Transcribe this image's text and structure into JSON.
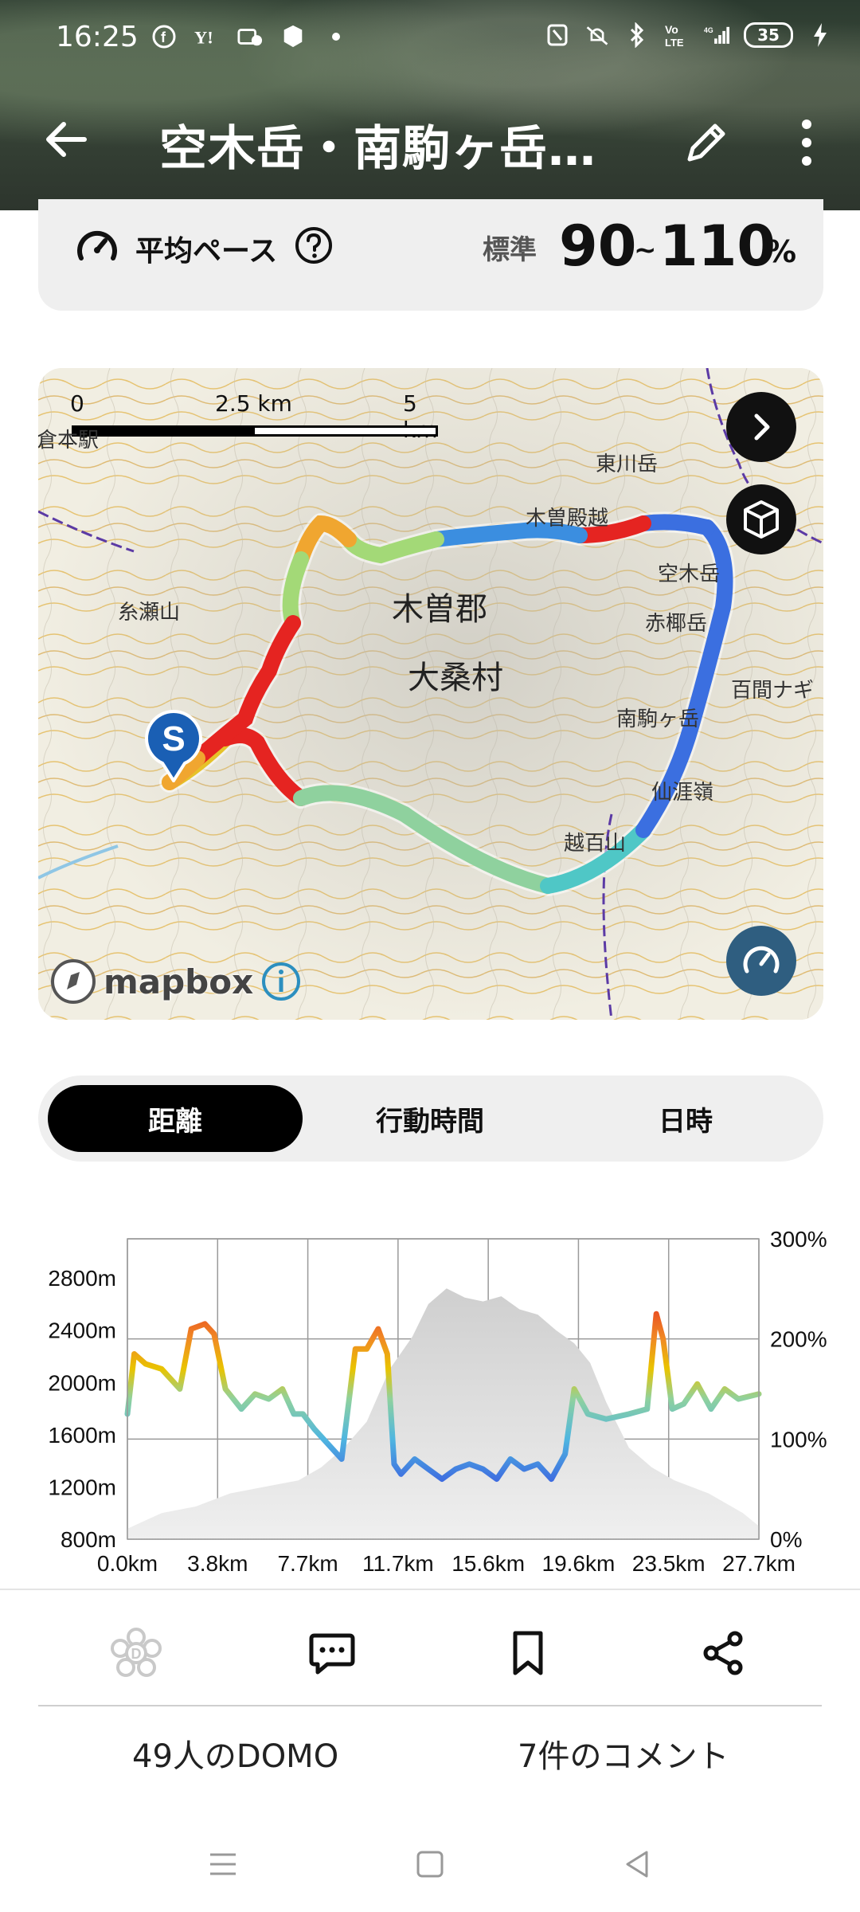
{
  "status_bar": {
    "time": "16:25",
    "battery": "35",
    "left_icons": [
      "facebook-icon",
      "yahoo-icon",
      "gallery-icon",
      "app-icon",
      "dot-icon"
    ],
    "right_icons": [
      "nfc-icon",
      "mute-icon",
      "bluetooth-icon",
      "volte-icon",
      "signal-icon",
      "battery-icon",
      "charging-icon"
    ]
  },
  "app_bar": {
    "title": "空木岳・南駒ヶ岳…"
  },
  "pace": {
    "label": "平均ペース",
    "standard_label": "標準",
    "min": "90",
    "tilde": "~",
    "max": "110",
    "unit": "%"
  },
  "map": {
    "scale": {
      "zero": "0",
      "mid": "2.5 km",
      "max": "5 km"
    },
    "place_labels": {
      "district": "木曽郡",
      "village": "大桑村",
      "mt_higashikawa": "東川岳",
      "mt_kisodono": "木曽殿越",
      "mt_utsugi": "空木岳",
      "mt_akanagi": "赤椰岳",
      "mt_minamikoma": "南駒ヶ岳",
      "mt_hyakkenagi": "百間ナギ",
      "mt_senjo": "仙涯嶺",
      "mt_koshiyuri": "越百山",
      "mt_itoze": "糸瀬山",
      "kura": "倉本駅"
    },
    "start_marker": "S",
    "attribution": "mapbox",
    "colors": {
      "route_fast": "#3b6fe0",
      "route_mid": "#8fd19e",
      "route_slow": "#e52421"
    }
  },
  "tabs": [
    {
      "label": "距離",
      "active": true
    },
    {
      "label": "行動時間",
      "active": false
    },
    {
      "label": "日時",
      "active": false
    }
  ],
  "chart_data": {
    "type": "line",
    "x_unit": "km",
    "xlim": [
      0,
      27.7
    ],
    "x_ticks": [
      "0.0km",
      "3.8km",
      "7.7km",
      "11.7km",
      "15.6km",
      "19.6km",
      "23.5km",
      "27.7km"
    ],
    "y_left_ticks": [
      "800m",
      "1200m",
      "1600m",
      "2000m",
      "2400m",
      "2800m"
    ],
    "y_left_lim": [
      800,
      3100
    ],
    "y_right_ticks": [
      "0%",
      "100%",
      "200%",
      "300%"
    ],
    "y_right_lim": [
      0,
      300
    ],
    "series": [
      {
        "type": "area",
        "x": [
          0,
          1.5,
          3,
          4.5,
          6,
          7.5,
          8.5,
          9.5,
          10.5,
          11.5,
          12.5,
          13.2,
          14,
          14.8,
          15.6,
          16.4,
          17.2,
          18,
          18.8,
          19.6,
          20.3,
          21,
          22,
          23,
          24,
          25.5,
          27,
          27.7
        ],
        "y": [
          880,
          1000,
          1050,
          1150,
          1200,
          1250,
          1350,
          1500,
          1700,
          2100,
          2350,
          2600,
          2720,
          2650,
          2620,
          2660,
          2560,
          2520,
          2400,
          2300,
          2150,
          1850,
          1500,
          1350,
          1250,
          1150,
          1000,
          900
        ]
      },
      {
        "type": "line",
        "x": [
          0,
          0.3,
          0.8,
          1.5,
          2.3,
          2.8,
          3.4,
          3.8,
          4.3,
          5,
          5.6,
          6.2,
          6.8,
          7.3,
          7.7,
          8.2,
          8.8,
          9.4,
          10,
          10.5,
          11,
          11.4,
          11.7,
          12,
          12.6,
          13.2,
          13.8,
          14.4,
          15,
          15.6,
          16.2,
          16.8,
          17.4,
          18,
          18.6,
          19.2,
          19.6,
          20.2,
          21,
          22,
          22.8,
          23.2,
          23.5,
          23.9,
          24.4,
          25,
          25.6,
          26.2,
          26.8,
          27.7
        ],
        "y": [
          125,
          185,
          175,
          170,
          150,
          210,
          215,
          205,
          150,
          130,
          145,
          140,
          150,
          125,
          125,
          110,
          95,
          80,
          190,
          190,
          210,
          185,
          75,
          65,
          80,
          70,
          60,
          70,
          75,
          70,
          60,
          80,
          70,
          75,
          60,
          85,
          150,
          125,
          120,
          125,
          130,
          225,
          200,
          130,
          135,
          155,
          130,
          150,
          140,
          145
        ]
      }
    ],
    "colors": {
      "area": "#d9d9d9",
      "fast": "#3b5ee0",
      "mid": "#8fd19e",
      "slow": "#e52421",
      "gold": "#e9c400"
    }
  },
  "actions": {
    "icons": [
      "domo-icon",
      "comment-icon",
      "bookmark-icon",
      "share-icon"
    ],
    "domo_count": "49人のDOMO",
    "comment_count": "7件のコメント"
  },
  "nav": {
    "icons": [
      "recent-apps-icon",
      "home-icon",
      "back-nav-icon"
    ]
  }
}
